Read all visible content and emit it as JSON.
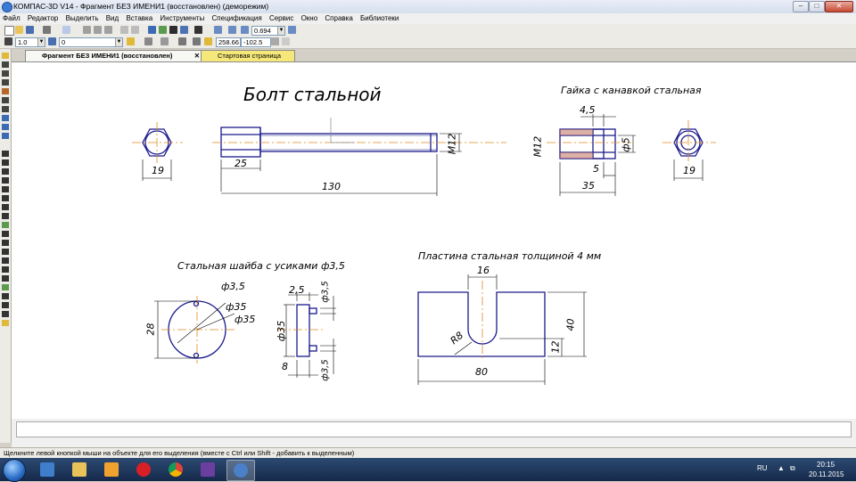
{
  "window": {
    "title": "КОМПАС-3D V14 - Фрагмент БЕЗ ИМЕНИ1 (восстановлен) (деморежим)",
    "controls": [
      "–",
      "□",
      "✕"
    ]
  },
  "menu": [
    "Файл",
    "Редактор",
    "Выделить",
    "Вид",
    "Вставка",
    "Инструменты",
    "Спецификация",
    "Сервис",
    "Окно",
    "Справка",
    "Библиотеки"
  ],
  "toolbar": {
    "zoom_value": "0.694",
    "coord_x": "258.66",
    "coord_y": "-102.5",
    "line_scale": "1.0",
    "layer": "0"
  },
  "tabs": [
    {
      "label": "Фрагмент БЕЗ ИМЕНИ1 (восстановлен)",
      "active": true
    },
    {
      "label": "Стартовая страница",
      "active": false
    }
  ],
  "drawing": {
    "bolt_title": "Болт стальной",
    "nut_title": "Гайка с канавкой стальная",
    "washer_title": "Стальная шайба с усиками ф3,5",
    "plate_title": "Пластина стальная толщиной 4 мм",
    "dims": {
      "bolt_hex": "19",
      "bolt_head": "25",
      "bolt_len": "130",
      "bolt_thread": "M12",
      "nut_groove": "4,5",
      "nut_thread": "M12",
      "nut_phi": "ф5",
      "nut_5": "5",
      "nut_35": "35",
      "nut_hex": "19",
      "w_phi35_small": "ф3,5",
      "w_phi35_a": "ф35",
      "w_phi35_b": "ф35",
      "w_28": "28",
      "w_25": "2,5",
      "w_phi35_top": "ф3,5",
      "w_phi35_side": "ф35",
      "w_8": "8",
      "w_phi35_bottom": "ф3,5",
      "p_16": "16",
      "p_r8": "R8",
      "p_40": "40",
      "p_12": "12",
      "p_80": "80"
    }
  },
  "status_text": "Щелкните левой кнопкой мыши на объекте для его выделения (вместе с Ctrl или Shift - добавить к выделенным)",
  "tray": {
    "lang": "RU",
    "time": "20:15",
    "date": "20.11.2015"
  },
  "colors": {
    "geometry": "#1a1a8c",
    "axis": "#e08a1e",
    "dimension": "#000000",
    "tab_start": "#f5e77a"
  }
}
